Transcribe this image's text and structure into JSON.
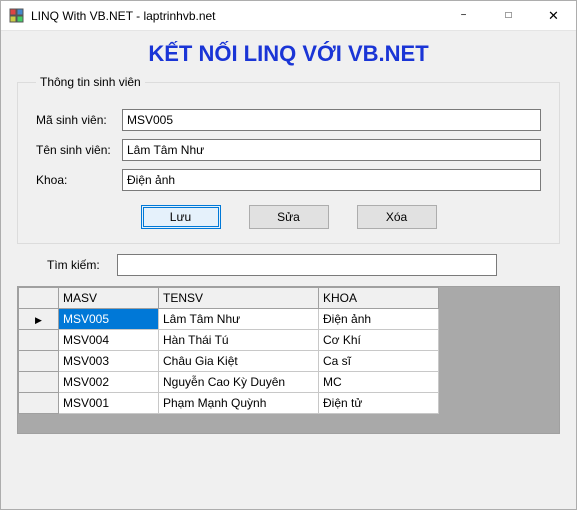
{
  "window": {
    "title": "LINQ With VB.NET - laptrinhvb.net"
  },
  "banner": "KẾT NỐI LINQ VỚI VB.NET",
  "group": {
    "legend": "Thông tin sinh viên",
    "fields": {
      "masv": {
        "label": "Mã sinh viên:",
        "value": "MSV005"
      },
      "tensv": {
        "label": "Tên sinh viên:",
        "value": "Lâm Tâm Như"
      },
      "khoa": {
        "label": "Khoa:",
        "value": "Điện ảnh"
      }
    },
    "buttons": {
      "save": "Lưu",
      "edit": "Sửa",
      "delete": "Xóa"
    }
  },
  "search": {
    "label": "Tìm kiếm:",
    "value": ""
  },
  "grid": {
    "headers": {
      "masv": "MASV",
      "tensv": "TENSV",
      "khoa": "KHOA"
    },
    "rows": [
      {
        "masv": "MSV005",
        "tensv": "Lâm Tâm Như",
        "khoa": "Điện ảnh",
        "selected": true,
        "current": true
      },
      {
        "masv": "MSV004",
        "tensv": "Hàn Thái Tú",
        "khoa": "Cơ Khí"
      },
      {
        "masv": "MSV003",
        "tensv": "Châu Gia Kiệt",
        "khoa": "Ca sĩ"
      },
      {
        "masv": "MSV002",
        "tensv": "Nguyễn Cao Kỳ Duyên",
        "khoa": "MC"
      },
      {
        "masv": "MSV001",
        "tensv": "Phạm Mạnh Quỳnh",
        "khoa": "Điện tử"
      }
    ]
  }
}
